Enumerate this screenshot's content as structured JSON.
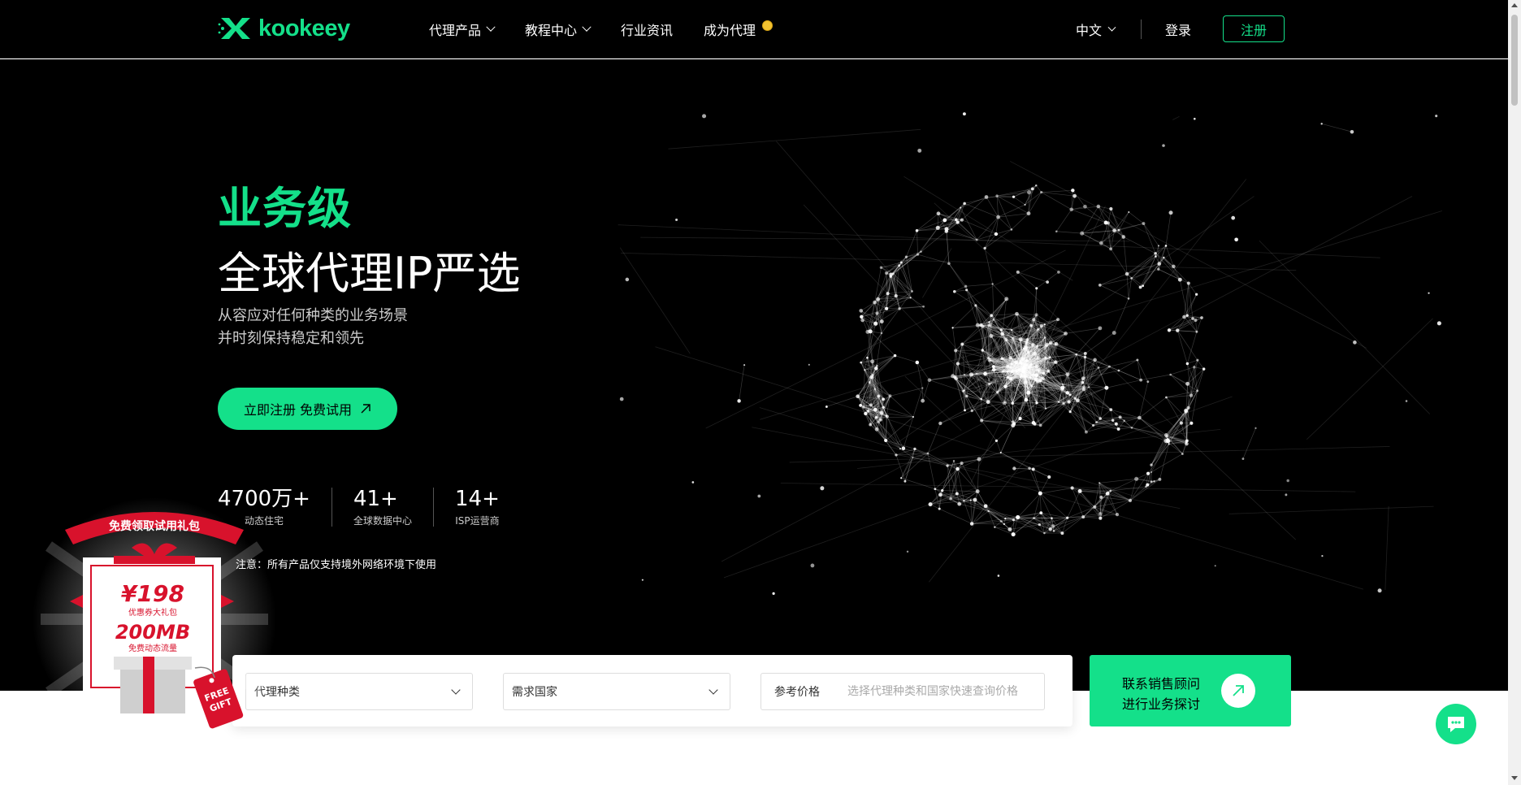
{
  "brand": {
    "name": "kookeey",
    "accent": "#14e08a"
  },
  "nav": {
    "items": [
      {
        "label": "代理产品",
        "has_dropdown": true
      },
      {
        "label": "教程中心",
        "has_dropdown": true
      },
      {
        "label": "行业资讯",
        "has_dropdown": false
      },
      {
        "label": "成为代理",
        "has_dropdown": false,
        "badge_icon": "coin-icon"
      }
    ],
    "language": "中文",
    "login": "登录",
    "register": "注册"
  },
  "hero": {
    "title_highlight": "业务级",
    "title_main": "全球代理IP严选",
    "subtitle_line1": "从容应对任何种类的业务场景",
    "subtitle_line2": "并时刻保持稳定和领先",
    "cta_label": "立即注册 免费试用",
    "stats": [
      {
        "value": "4700万+",
        "label": "动态住宅"
      },
      {
        "value": "41+",
        "label": "全球数据中心"
      },
      {
        "value": "14+",
        "label": "ISP运营商"
      }
    ],
    "notice": "注意：所有产品仅支持境外网络环境下使用"
  },
  "search": {
    "proxy_type_placeholder": "代理种类",
    "country_placeholder": "需求国家",
    "price_label": "参考价格",
    "price_placeholder": "选择代理种类和国家快速查询价格"
  },
  "contact": {
    "line1": "联系销售顾问",
    "line2": "进行业务探讨"
  },
  "gift": {
    "ribbon_text": "免费领取试用礼包",
    "amount": "¥198",
    "amount_caption": "优惠券大礼包",
    "traffic": "200MB",
    "traffic_caption": "免费动态流量",
    "tag_line1": "FREE",
    "tag_line2": "GIFT"
  }
}
